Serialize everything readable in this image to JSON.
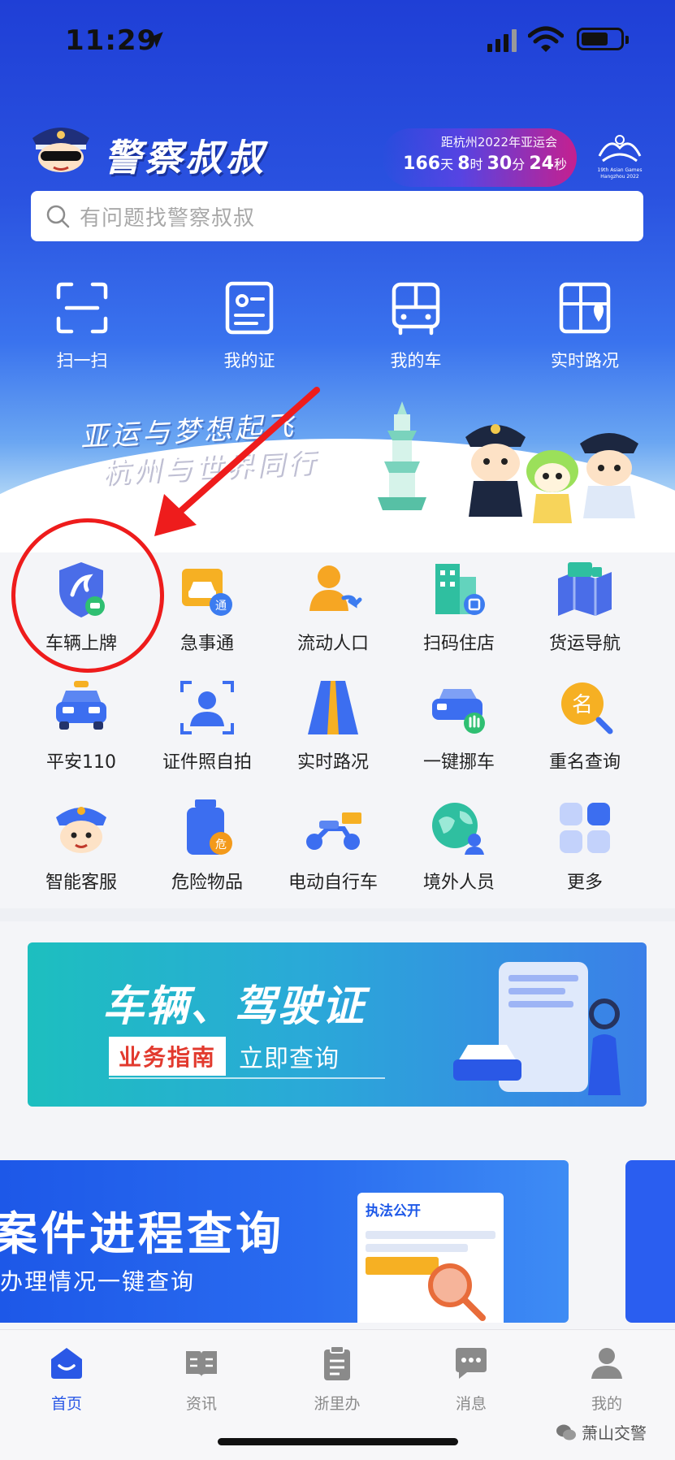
{
  "status_bar": {
    "time": "11:29"
  },
  "header": {
    "app_title": "警察叔叔",
    "countdown_label": "距杭州2022年亚运会",
    "countdown": {
      "days": "166",
      "days_unit": "天",
      "hours": "8",
      "hours_unit": "时",
      "minutes": "30",
      "minutes_unit": "分",
      "seconds": "24",
      "seconds_unit": "秒"
    },
    "asian_games_caption": "19th Asian Games Hangzhou 2022"
  },
  "search": {
    "placeholder": "有问题找警察叔叔"
  },
  "quick_actions": [
    {
      "label": "扫一扫",
      "icon": "scan-icon"
    },
    {
      "label": "我的证",
      "icon": "id-card-icon"
    },
    {
      "label": "我的车",
      "icon": "bus-icon"
    },
    {
      "label": "实时路况",
      "icon": "map-icon"
    }
  ],
  "banner_slogan": {
    "line1": "亚运与梦想起飞",
    "line2": "杭州与世界同行"
  },
  "services": [
    {
      "label": "车辆上牌",
      "icon": "vehicle-plate-icon"
    },
    {
      "label": "急事通",
      "icon": "urgent-car-icon"
    },
    {
      "label": "流动人口",
      "icon": "floating-population-icon"
    },
    {
      "label": "扫码住店",
      "icon": "hotel-scan-icon"
    },
    {
      "label": "货运导航",
      "icon": "freight-nav-icon"
    },
    {
      "label": "平安110",
      "icon": "police-car-icon"
    },
    {
      "label": "证件照自拍",
      "icon": "id-photo-icon"
    },
    {
      "label": "实时路况",
      "icon": "road-icon"
    },
    {
      "label": "一键挪车",
      "icon": "move-car-icon"
    },
    {
      "label": "重名查询",
      "icon": "name-search-icon"
    },
    {
      "label": "智能客服",
      "icon": "customer-service-icon"
    },
    {
      "label": "危险物品",
      "icon": "hazard-icon"
    },
    {
      "label": "电动自行车",
      "icon": "ebike-icon"
    },
    {
      "label": "境外人员",
      "icon": "globe-person-icon"
    },
    {
      "label": "更多",
      "icon": "more-grid-icon"
    }
  ],
  "banner_vehicle": {
    "title": "车辆、驾驶证",
    "tag": "业务指南",
    "action": "立即查询"
  },
  "banner_case": {
    "title": "案件进程查询",
    "subtitle": "办理情况一键查询",
    "doc_header": "执法公开"
  },
  "tabbar": [
    {
      "label": "首页",
      "icon": "home-icon",
      "active": true
    },
    {
      "label": "资讯",
      "icon": "news-icon",
      "active": false
    },
    {
      "label": "浙里办",
      "icon": "clipboard-icon",
      "active": false
    },
    {
      "label": "消息",
      "icon": "message-icon",
      "active": false
    },
    {
      "label": "我的",
      "icon": "profile-icon",
      "active": false
    }
  ],
  "watermark": "萧山交警",
  "colors": {
    "brand_blue": "#2a58e6",
    "annotation_red": "#ee1c1c",
    "hazard_orange": "#f39a1b"
  }
}
